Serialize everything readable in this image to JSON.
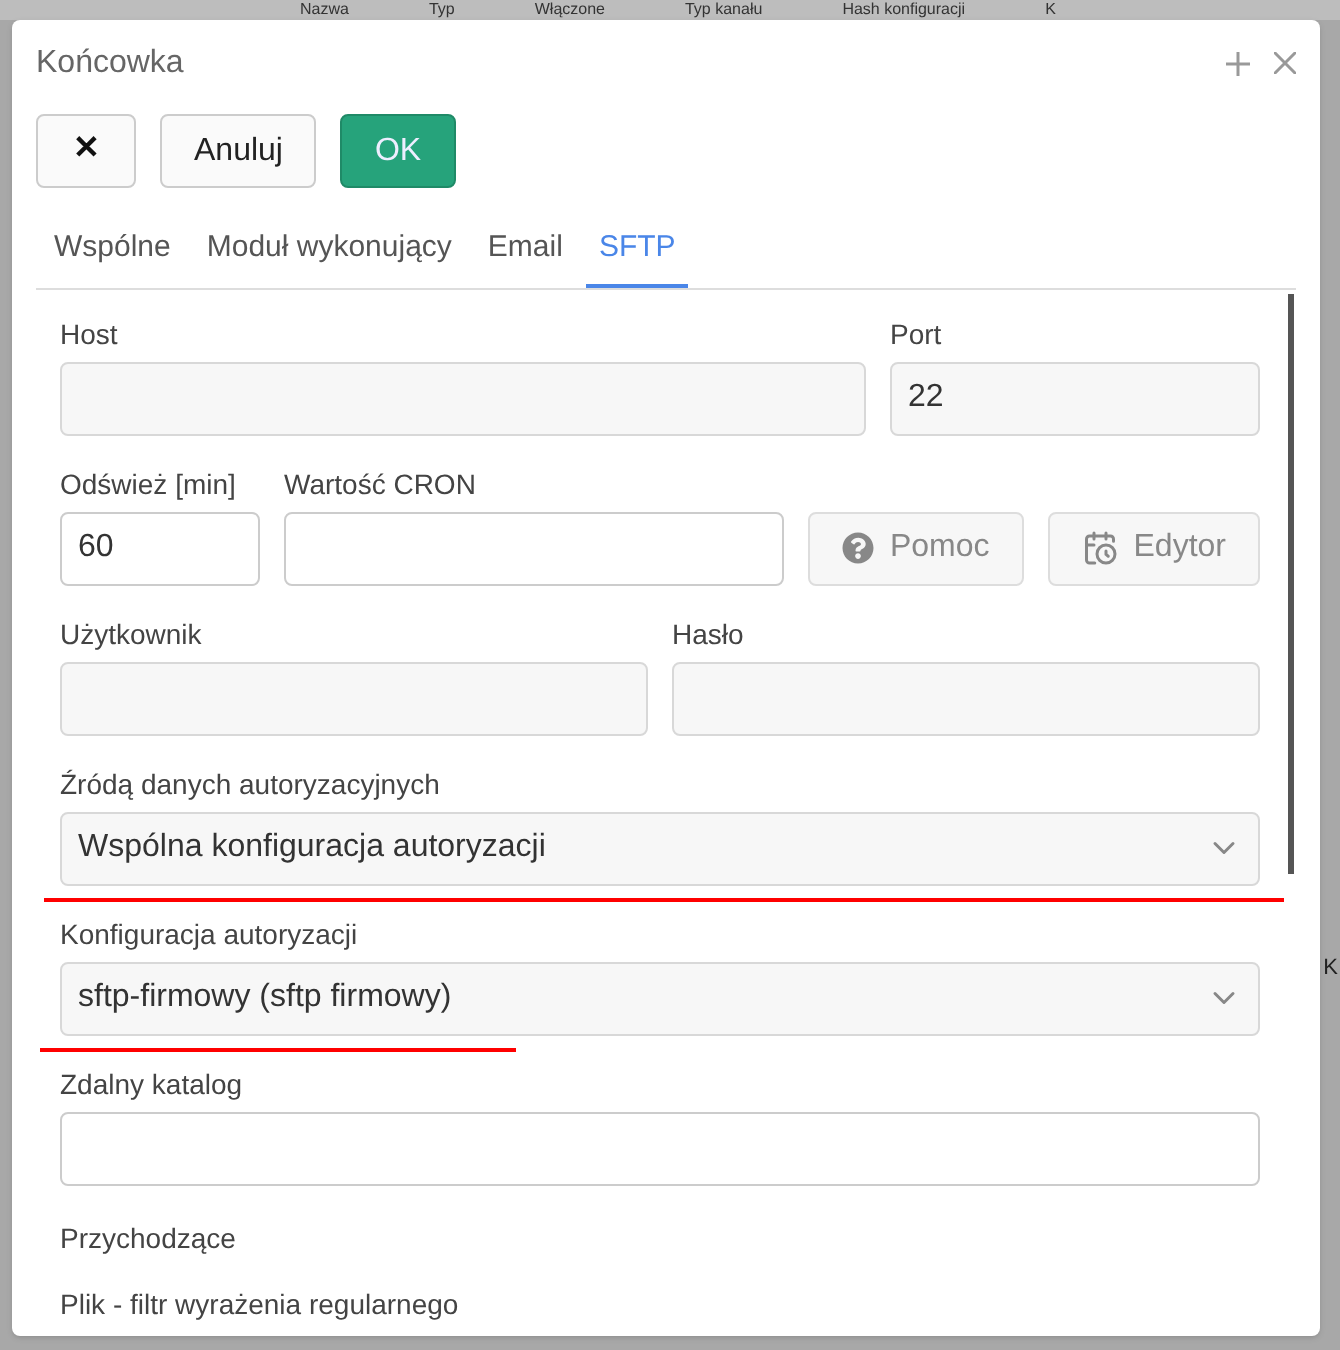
{
  "background_table": {
    "columns": [
      "Nazwa",
      "Typ",
      "Włączone",
      "Typ kanału",
      "Hash konfiguracji",
      "K"
    ],
    "side_text": "K"
  },
  "dialog": {
    "title": "Końcowka",
    "toolbar": [
      {
        "kind": "close",
        "label": "✕"
      },
      {
        "kind": "plain",
        "label": "Anuluj"
      },
      {
        "kind": "primary",
        "label": "OK"
      }
    ],
    "tabs": [
      {
        "label": "Wspólne",
        "selected": false
      },
      {
        "label": "Moduł wykonujący",
        "selected": false
      },
      {
        "label": "Email",
        "selected": false
      },
      {
        "label": "SFTP",
        "selected": true
      }
    ],
    "rows": [
      {
        "fields": [
          {
            "kind": "text",
            "label": "Host",
            "disabled": true
          },
          {
            "kind": "text",
            "label": "Port",
            "value": "22",
            "disabled": true
          }
        ]
      },
      {
        "fields": [
          {
            "kind": "text",
            "label": "Odśwież [min]",
            "value": "60",
            "disabled": false
          },
          {
            "kind": "text",
            "label": "Wartość CRON",
            "disabled": false
          },
          {
            "kind": "button",
            "label": "Pomoc",
            "disabled": true
          },
          {
            "kind": "button",
            "label": "Edytor",
            "disabled": true
          }
        ]
      },
      {
        "fields": [
          {
            "kind": "text",
            "label": "Użytkownik",
            "disabled": true
          },
          {
            "kind": "text",
            "label": "Hasło",
            "disabled": true
          }
        ]
      },
      {
        "fields": [
          {
            "kind": "select",
            "label": "Źródą danych autoryzacyjnych",
            "value": "Wspólna konfiguracja autoryzacji",
            "underlined": true
          }
        ]
      },
      {
        "fields": [
          {
            "kind": "select",
            "label": "Konfiguracja autoryzacji",
            "value": "sftp-firmowy (sftp firmowy)",
            "underlined": true
          }
        ]
      },
      {
        "fields": [
          {
            "kind": "text",
            "label": "Zdalny katalog",
            "disabled": false
          }
        ]
      }
    ],
    "section": "Przychodzące",
    "next_label": "Plik - filtr wyrażenia regularnego"
  }
}
